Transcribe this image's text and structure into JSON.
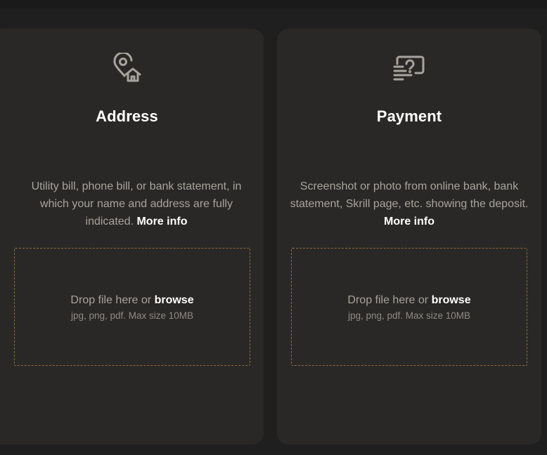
{
  "theme": {
    "page_bg": "#1f1f1f",
    "card_bg": "#2a2827",
    "title_color": "#ffffff",
    "muted_text": "#a8a39c",
    "dropzone_border": "#8b6a3a",
    "icon_color": "#a8a39c"
  },
  "cards": [
    {
      "id": "address",
      "icon": "location-home-icon",
      "title": "Address",
      "description": "Utility bill, phone bill, or bank statement, in which your name and address are fully indicated.",
      "more_info": "More info",
      "drop_text": "Drop file here or",
      "browse": "browse",
      "hint": "jpg, png, pdf. Max size 10MB"
    },
    {
      "id": "payment",
      "icon": "payment-cash-icon",
      "title": "Payment",
      "description": "Screenshot or photo from online bank, bank statement, Skrill page, etc. showing the deposit.",
      "more_info": "More info",
      "drop_text": "Drop file here or",
      "browse": "browse",
      "hint": "jpg, png, pdf. Max size 10MB"
    }
  ]
}
